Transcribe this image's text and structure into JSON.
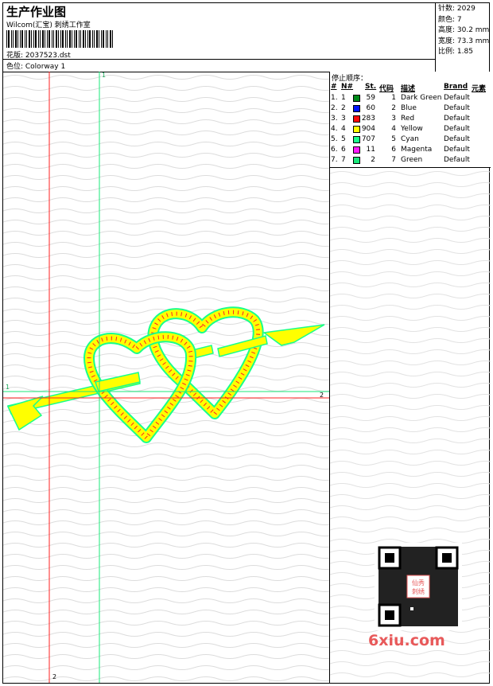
{
  "header": {
    "title": "生产作业图",
    "company": "Wilcom(汇宝) 刺绣工作室",
    "design_label": "花版: 2037523.dst",
    "colorway_label": "色位: Colorway 1"
  },
  "stats": {
    "stitches": "针数: 2029",
    "colors": "颜色: 7",
    "height": "高度: 30.2 mm",
    "width": "宽度: 73.3 mm",
    "scale": "比例: 1.85"
  },
  "stop_sequence": {
    "title": "停止顺序：",
    "headers": {
      "num": "#",
      "no": "N#",
      "st": "St.",
      "code": "代码",
      "desc": "描述",
      "brand": "Brand",
      "element": "元素"
    },
    "rows": [
      {
        "num": "1.",
        "no": "1",
        "color": "#008a1a",
        "st": "59",
        "code": "1",
        "desc": "Dark Green",
        "brand": "Default"
      },
      {
        "num": "2.",
        "no": "2",
        "color": "#0014ff",
        "st": "60",
        "code": "2",
        "desc": "Blue",
        "brand": "Default"
      },
      {
        "num": "3.",
        "no": "3",
        "color": "#ff0a0a",
        "st": "283",
        "code": "3",
        "desc": "Red",
        "brand": "Default"
      },
      {
        "num": "4.",
        "no": "4",
        "color": "#ffff00",
        "st": "904",
        "code": "4",
        "desc": "Yellow",
        "brand": "Default"
      },
      {
        "num": "5.",
        "no": "5",
        "color": "#19ff8a",
        "st": "707",
        "code": "5",
        "desc": "Cyan",
        "brand": "Default"
      },
      {
        "num": "6.",
        "no": "6",
        "color": "#ff1aff",
        "st": "11",
        "code": "6",
        "desc": "Magenta",
        "brand": "Default"
      },
      {
        "num": "7.",
        "no": "7",
        "color": "#19e87a",
        "st": "2",
        "code": "7",
        "desc": "Green",
        "brand": "Default"
      }
    ]
  },
  "axis_labels": {
    "green_v": "1",
    "green_h": "1",
    "red_h": "2",
    "red_v": "2"
  },
  "watermark": {
    "logo": "6xiu.com",
    "qr_seal": "仙秀刺绣"
  },
  "colors": {
    "red_axis": "#ff2020",
    "green_axis": "#19e87a",
    "fill": "#ffff00",
    "outline": "#19ff8a"
  }
}
